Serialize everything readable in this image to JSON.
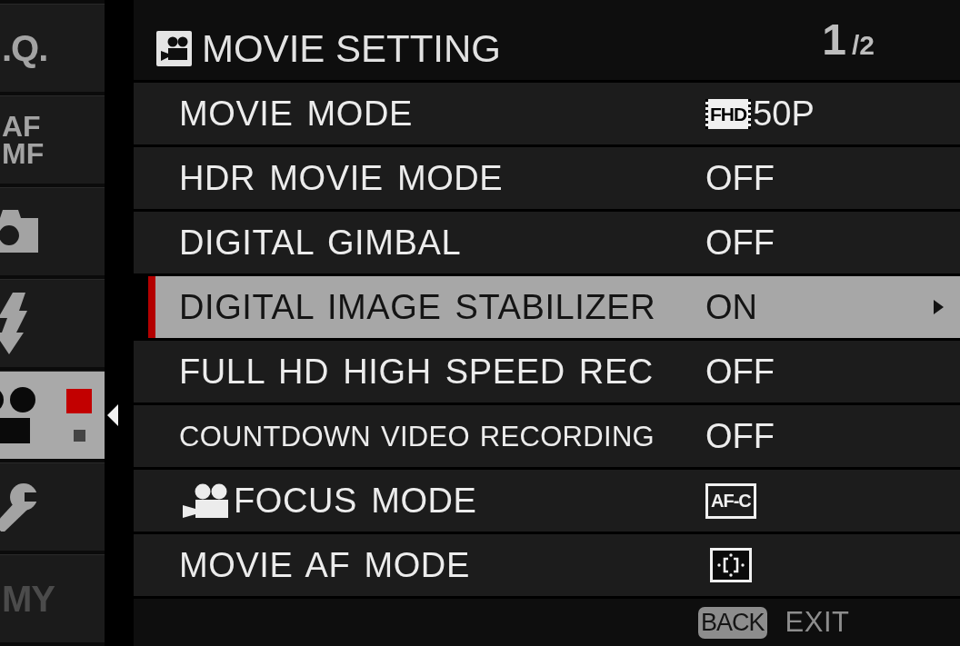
{
  "sidebar": {
    "tabs": [
      {
        "kind": "text",
        "lines": [
          ".Q."
        ],
        "selected": false,
        "disabled": false
      },
      {
        "kind": "text",
        "lines": [
          "AF",
          "MF"
        ],
        "selected": false,
        "disabled": false
      },
      {
        "kind": "shooting",
        "selected": false,
        "disabled": false
      },
      {
        "kind": "flash",
        "selected": false,
        "disabled": false
      },
      {
        "kind": "movie",
        "selected": true,
        "disabled": false,
        "pages": [
          {
            "selected": true
          },
          {
            "selected": false
          }
        ]
      },
      {
        "kind": "setup",
        "selected": false,
        "disabled": false
      },
      {
        "kind": "text",
        "lines": [
          "MY"
        ],
        "selected": false,
        "disabled": true
      }
    ]
  },
  "header": {
    "title": "MOVIE SETTING",
    "page": {
      "current": "1",
      "of_total": "/2"
    }
  },
  "rows": [
    {
      "label": "MOVIE MODE",
      "selected": false,
      "condensed": false,
      "label_icon": false,
      "value": {
        "kind": "badge_text",
        "badge": "FHD",
        "text": "50P"
      }
    },
    {
      "label": "HDR MOVIE MODE",
      "selected": false,
      "condensed": false,
      "label_icon": false,
      "value": {
        "kind": "text",
        "text": "OFF"
      }
    },
    {
      "label": "DIGITAL GIMBAL",
      "selected": false,
      "condensed": false,
      "label_icon": false,
      "value": {
        "kind": "text",
        "text": "OFF"
      }
    },
    {
      "label": "DIGITAL IMAGE STABILIZER",
      "selected": true,
      "condensed": false,
      "label_icon": false,
      "value": {
        "kind": "text",
        "text": "ON"
      }
    },
    {
      "label": "FULL HD HIGH SPEED REC",
      "selected": false,
      "condensed": false,
      "label_icon": false,
      "value": {
        "kind": "text",
        "text": "OFF"
      }
    },
    {
      "label": "COUNTDOWN VIDEO RECORDING",
      "selected": false,
      "condensed": true,
      "label_icon": false,
      "value": {
        "kind": "text",
        "text": "OFF"
      }
    },
    {
      "label": "FOCUS MODE",
      "selected": false,
      "condensed": false,
      "label_icon": true,
      "value": {
        "kind": "framed_badge",
        "badge": "AF-C"
      }
    },
    {
      "label": "MOVIE AF MODE",
      "selected": false,
      "condensed": false,
      "label_icon": false,
      "value": {
        "kind": "icon"
      }
    }
  ],
  "footer": {
    "key": "BACK",
    "action": "EXIT"
  }
}
